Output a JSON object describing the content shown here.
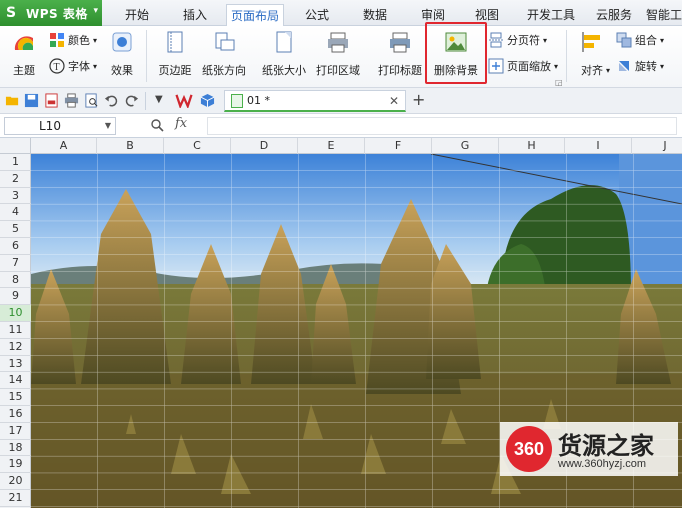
{
  "app": {
    "title": "WPS 表格"
  },
  "menu": {
    "tabs": [
      {
        "label": "开始"
      },
      {
        "label": "插入"
      },
      {
        "label": "页面布局"
      },
      {
        "label": "公式"
      },
      {
        "label": "数据"
      },
      {
        "label": "审阅"
      },
      {
        "label": "视图"
      },
      {
        "label": "开发工具"
      },
      {
        "label": "云服务"
      },
      {
        "label": "智能工"
      }
    ],
    "active": "页面布局"
  },
  "ribbon": {
    "theme": "主题",
    "colors": "颜色",
    "fonts": "字体",
    "effects": "效果",
    "margins": "页边距",
    "orientation": "纸张方向",
    "size": "纸张大小",
    "print_area": "打印区域",
    "print_titles": "打印标题",
    "remove_background": "删除背景",
    "page_break": "分页符",
    "page_zoom": "页面缩放",
    "align": "对齐",
    "group": "组合",
    "rotate": "旋转"
  },
  "doc_tab": {
    "name": "01 *"
  },
  "formula": {
    "name_box": "L10",
    "fx": "fx",
    "value": ""
  },
  "columns": [
    "A",
    "B",
    "C",
    "D",
    "E",
    "F",
    "G",
    "H",
    "I",
    "J"
  ],
  "rows": [
    "1",
    "2",
    "3",
    "4",
    "5",
    "6",
    "7",
    "8",
    "9",
    "10",
    "11",
    "12",
    "13",
    "14",
    "15",
    "16",
    "17",
    "18",
    "19",
    "20",
    "21"
  ],
  "selected_row": "10",
  "watermark": {
    "brand": "360",
    "text": "货源之家",
    "url": "www.360hyzj.com"
  },
  "colors": {
    "accent_green": "#2e8f2e",
    "active_tab_blue": "#2b6cc4",
    "highlight_red": "#e0272f"
  }
}
